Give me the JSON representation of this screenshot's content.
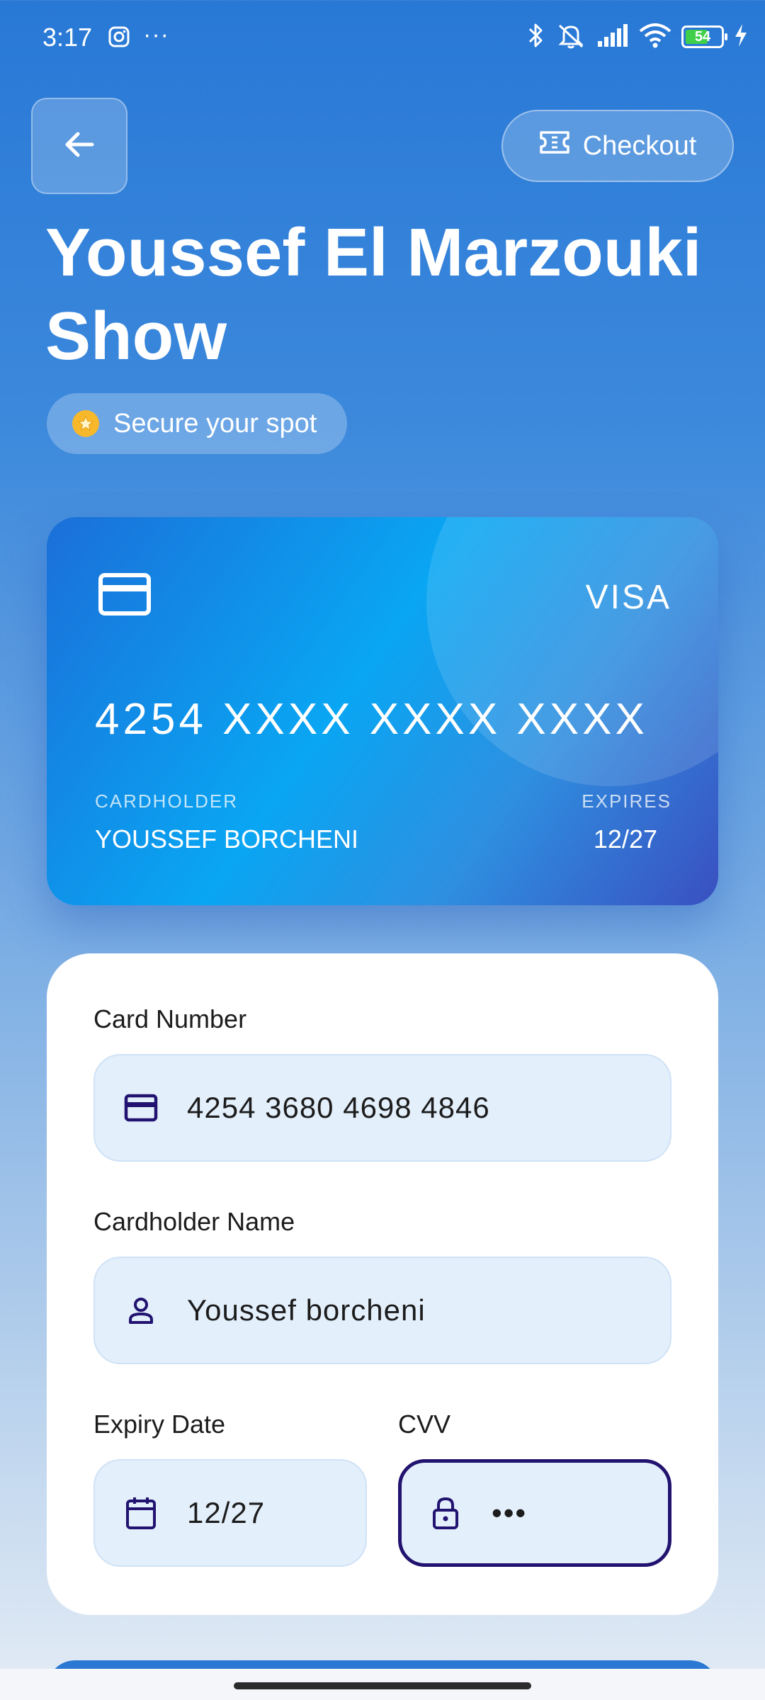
{
  "status_bar": {
    "time": "3:17",
    "more": "···",
    "battery": "54",
    "icons": [
      "instagram-icon",
      "bluetooth-icon",
      "mute-icon",
      "signal-icon",
      "wifi-icon",
      "battery-icon",
      "charging-icon"
    ]
  },
  "header": {
    "checkout_label": "Checkout",
    "title": "Youssef El Marzouki Show",
    "badge": "Secure your spot"
  },
  "card": {
    "brand": "VISA",
    "number": "4254 XXXX XXXX XXXX",
    "holder_label": "CARDHOLDER",
    "holder": "YOUSSEF BORCHENI",
    "expires_label": "EXPIRES",
    "expires": "12/27"
  },
  "form": {
    "card_number_label": "Card Number",
    "card_number": "4254 3680 4698 4846",
    "name_label": "Cardholder Name",
    "name": "Youssef borcheni",
    "expiry_label": "Expiry Date",
    "expiry": "12/27",
    "cvv_label": "CVV",
    "cvv": "•••"
  },
  "colors": {
    "background_top": "#2878d6",
    "accent_dark": "#21136f",
    "field_bg": "#e3effb",
    "badge_star": "#f7b92b"
  }
}
